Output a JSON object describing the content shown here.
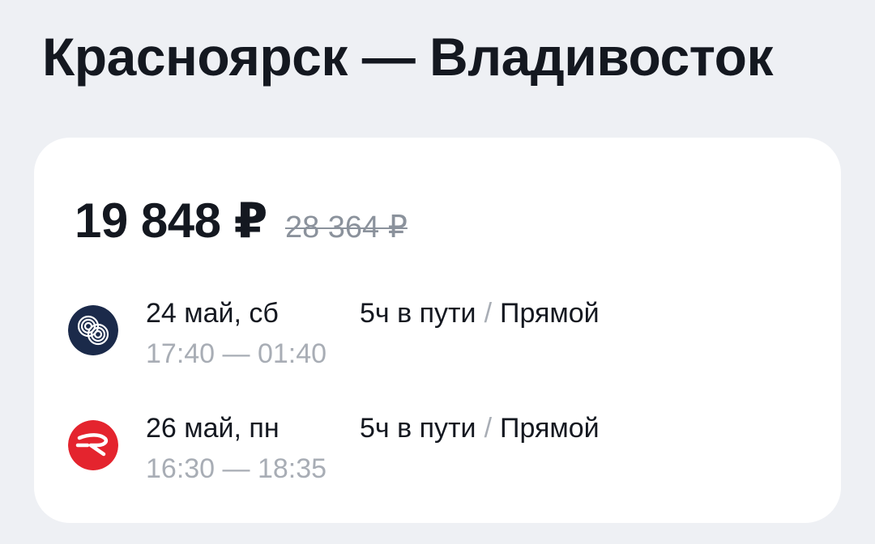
{
  "route": {
    "title": "Красноярск — Владивосток"
  },
  "offer": {
    "price_current": "19 848 ₽",
    "price_old": "28 364 ₽",
    "flights": [
      {
        "airline_icon": "airline-swirl-logo-icon",
        "date": "24 май, сб",
        "times": "17:40 — 01:40",
        "duration": "5ч в пути",
        "separator": "/",
        "type": "Прямой"
      },
      {
        "airline_icon": "airline-r-logo-icon",
        "date": "26 май, пн",
        "times": "16:30 — 18:35",
        "duration": "5ч в пути",
        "separator": "/",
        "type": "Прямой"
      }
    ]
  },
  "colors": {
    "background": "#eef0f4",
    "card": "#ffffff",
    "text_primary": "#141820",
    "text_secondary": "#a8adb5",
    "logo_navy": "#1b2a4a",
    "logo_red": "#e4242e"
  }
}
